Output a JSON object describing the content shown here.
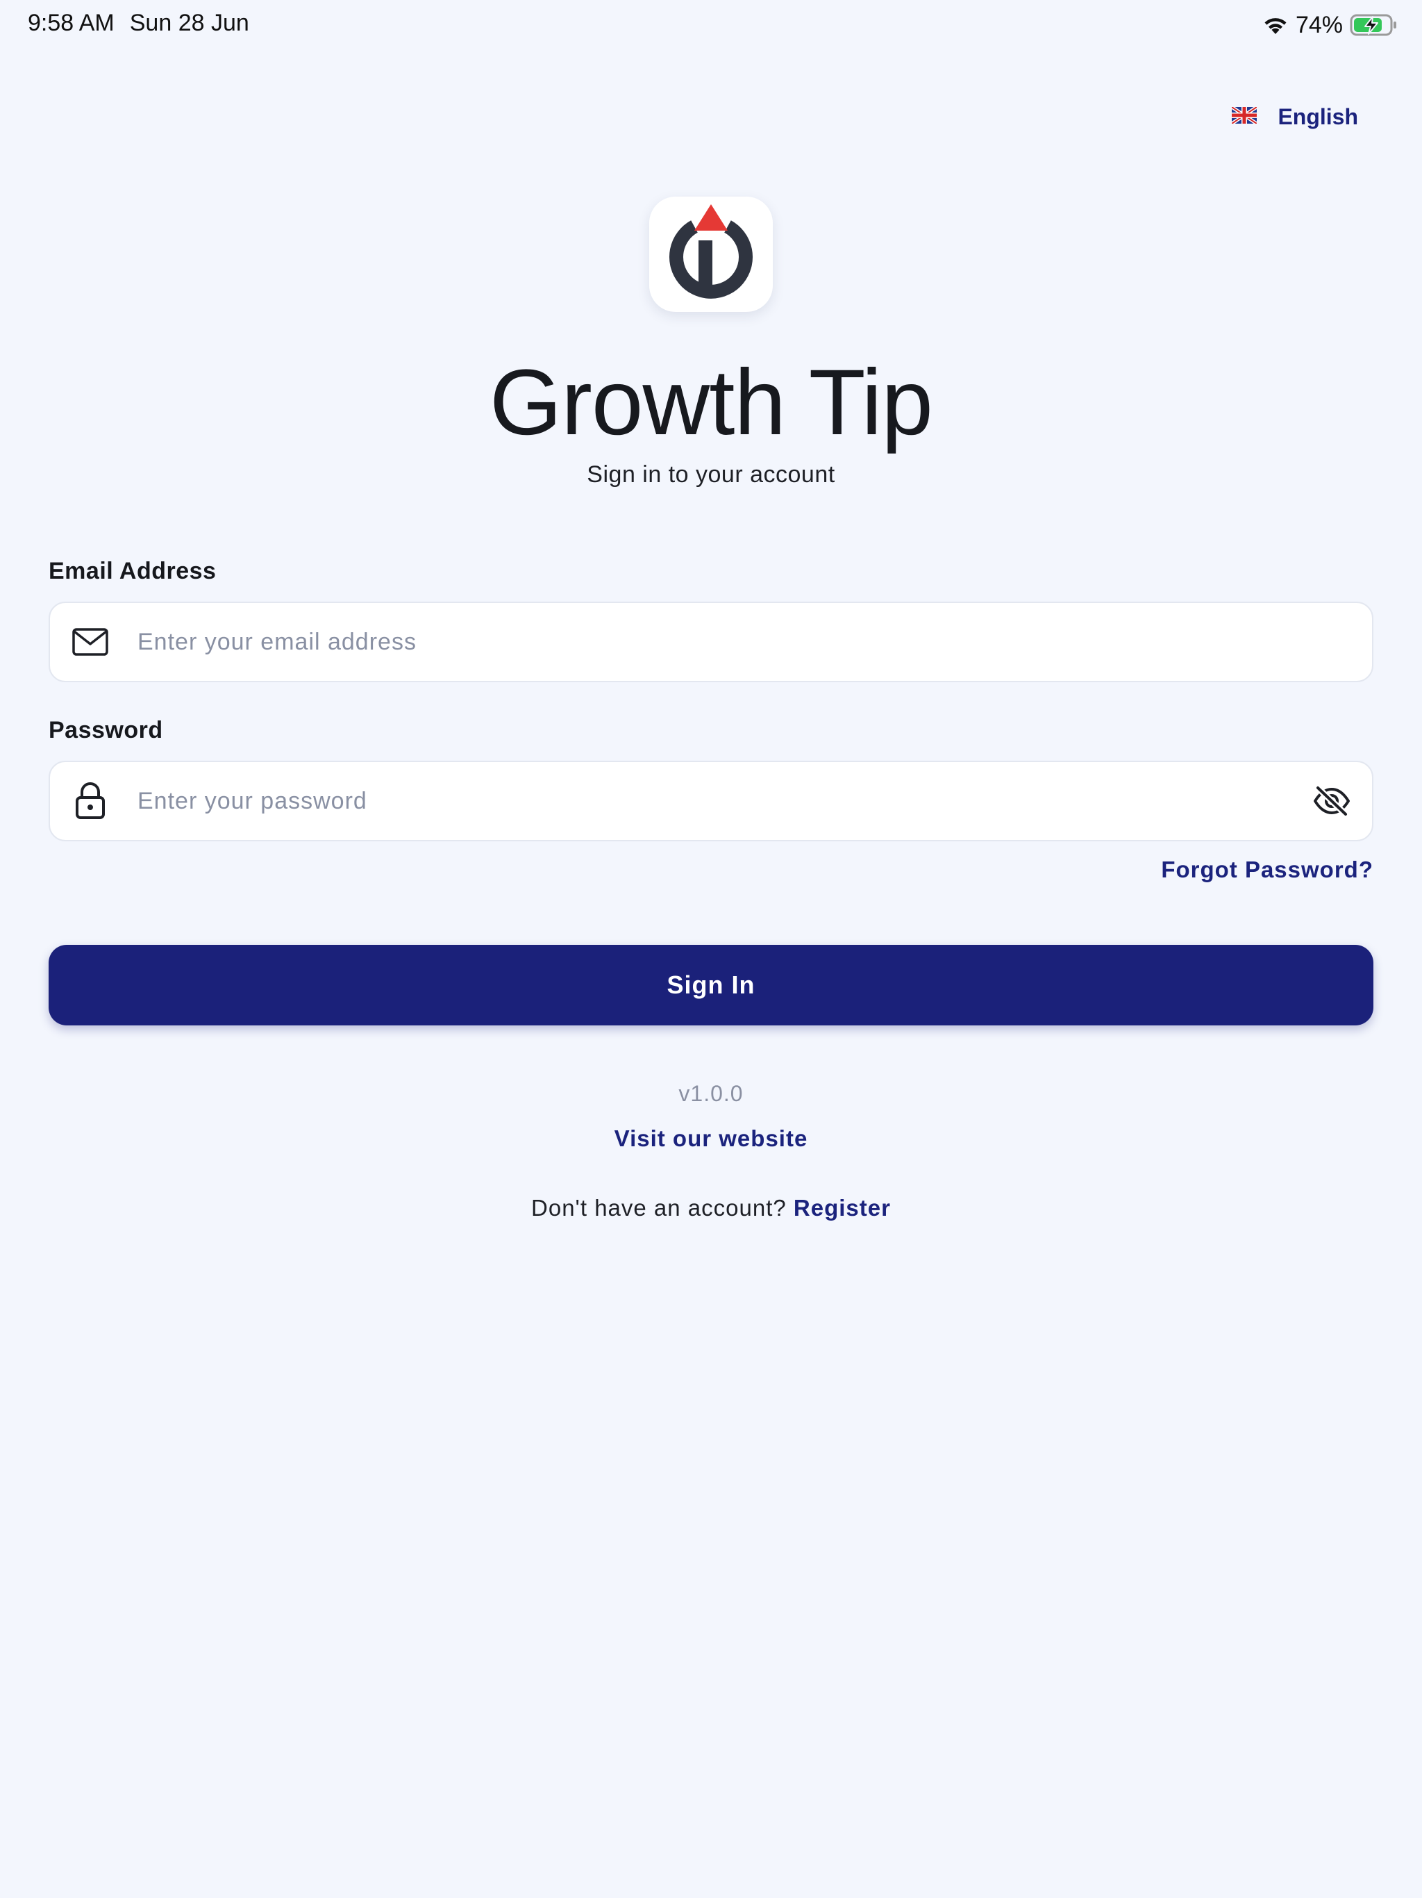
{
  "status_bar": {
    "time": "9:58 AM",
    "date": "Sun 28 Jun",
    "battery_percent": "74%",
    "battery_level": 0.74,
    "charging": true
  },
  "language": {
    "flag_icon": "uk-flag-icon",
    "label": "English"
  },
  "app": {
    "logo_icon": "growth-tip-logo",
    "title": "Growth Tip",
    "subtitle": "Sign in to your account"
  },
  "form": {
    "email": {
      "label": "Email Address",
      "placeholder": "Enter your email address",
      "value": "",
      "icon": "mail-icon"
    },
    "password": {
      "label": "Password",
      "placeholder": "Enter your password",
      "value": "",
      "icon": "lock-icon",
      "toggle_icon": "eye-off-icon"
    },
    "forgot_password": "Forgot Password?",
    "submit_label": "Sign In"
  },
  "footer": {
    "version": "v1.0.0",
    "website_link": "Visit our website",
    "register_prompt": "Don't have an account?",
    "register_link": "Register"
  },
  "colors": {
    "background": "#f3f6fd",
    "primary": "#1b217a",
    "link": "#1b237d",
    "logo_red": "#e53935",
    "logo_dark": "#2f3440"
  }
}
